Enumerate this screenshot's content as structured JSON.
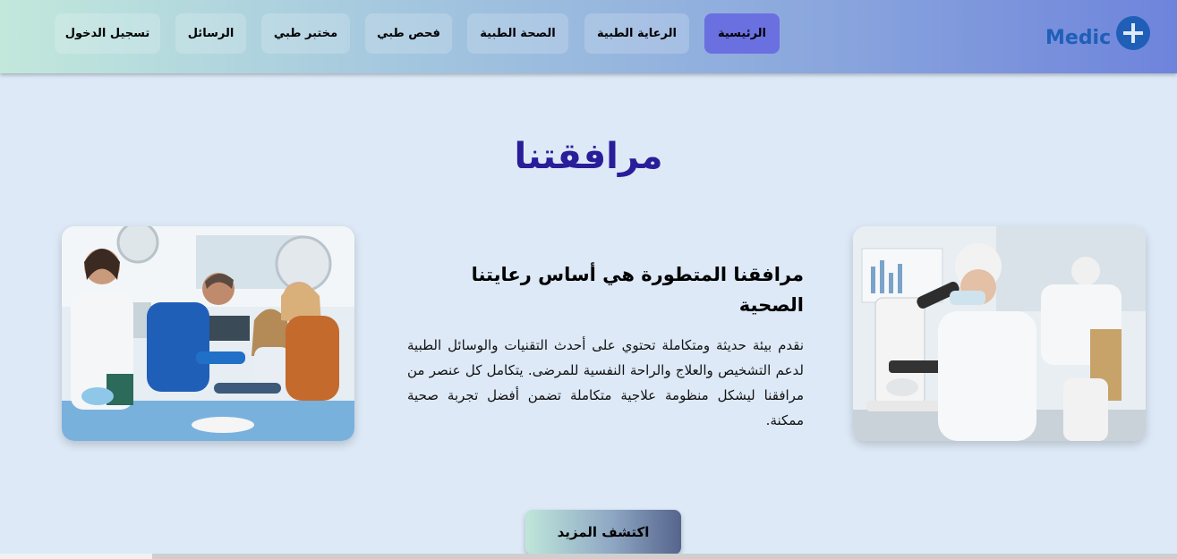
{
  "header": {
    "logo_text": "Medic",
    "logo_icon": "plus-circle-icon",
    "nav": [
      {
        "label": "الرئيسية",
        "active": true
      },
      {
        "label": "الرعاية الطبية",
        "active": false
      },
      {
        "label": "الصحة الطبية",
        "active": false
      },
      {
        "label": "فحص طبي",
        "active": false
      },
      {
        "label": "مختبر طبي",
        "active": false
      },
      {
        "label": "الرسائل",
        "active": false
      },
      {
        "label": "تسجيل الدخول",
        "active": false
      }
    ]
  },
  "section": {
    "title": "مرافقتنا",
    "heading": "مرافقنا المتطورة هي أساس رعايتنا الصحية",
    "body": "نقدم بيئة حديثة ومتكاملة تحتوي على أحدث التقنيات والوسائل الطبية لدعم التشخيص والعلاج والراحة النفسية للمرضى. يتكامل كل عنصر من مرافقنا ليشكل منظومة علاجية متكاملة تضمن أفضل تجربة صحية ممكنة.",
    "cta_label": "اكتشف المزيد"
  },
  "colors": {
    "accent": "#6a70e0",
    "title": "#2a1d9a",
    "brand": "#1f5fb8",
    "background": "#dde9f7"
  }
}
